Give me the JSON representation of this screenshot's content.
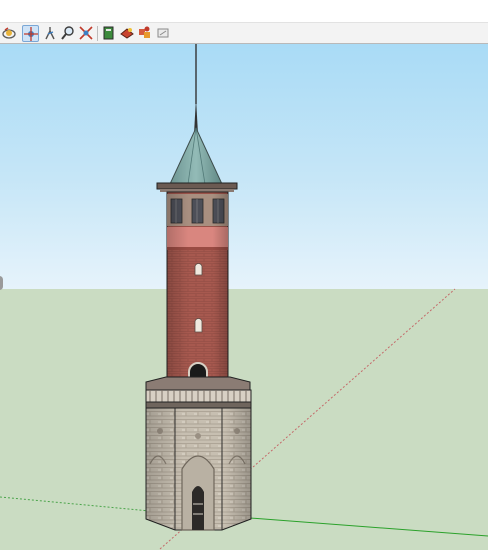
{
  "toolbar": {
    "tools": [
      {
        "name": "orbit-icon",
        "active": false
      },
      {
        "name": "pan-icon",
        "active": true
      },
      {
        "name": "walk-icon",
        "active": false
      },
      {
        "name": "zoom-icon",
        "active": false
      },
      {
        "name": "zoom-extents-icon",
        "active": false
      },
      {
        "name": "model-info-icon",
        "active": false
      },
      {
        "name": "materials-icon",
        "active": false
      },
      {
        "name": "components-icon",
        "active": false
      },
      {
        "name": "styles-icon",
        "active": false
      }
    ]
  },
  "scene": {
    "model": "octagonal-brick-tower",
    "colors": {
      "sky_top": "#a9dbf6",
      "sky_horizon": "#e6f3fb",
      "ground": "#cadcc2",
      "brick": "#a7594f",
      "roof": "#7fa9a7",
      "stone": "#c7bfb1",
      "axis_red": "#c46a6a",
      "axis_green": "#2aa12a"
    }
  }
}
